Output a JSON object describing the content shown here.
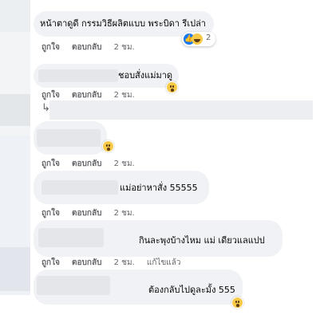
{
  "comments": [
    {
      "text": "หน้าตาดูดี กรรมวิธีผลิตแบบ พระบิดา รีเปล่า",
      "reaction_count": "2",
      "like": "ถูกใจ",
      "reply": "ตอบกลับ",
      "time": "2 ชม."
    },
    {
      "text": "ชอบสั่งแม่มาดู",
      "like": "ถูกใจ",
      "reply": "ตอบกลับ",
      "time": "2 ชม."
    },
    {
      "text": "",
      "like": "ถูกใจ",
      "reply": "ตอบกลับ",
      "time": "2 ชม."
    },
    {
      "text": "แม่อย่าหาสั่ง 55555",
      "like": "ถูกใจ",
      "reply": "ตอบกลับ",
      "time": "2 ชม."
    },
    {
      "text": "กินละพุงบ้างไหม แม่ เดียวแลแปป",
      "like": "ถูกใจ",
      "reply": "ตอบกลับ",
      "time": "2 ชม.",
      "edited": "แก้ไขแล้ว"
    },
    {
      "text": "ต้องกลับไปดูละมั้ง 555"
    }
  ],
  "reply_arrow": "↳",
  "colors": {
    "bubble": "#f0f2f5",
    "meta": "#65676b",
    "like_blue": "#1877f2",
    "emoji_yellow": "#f7c948"
  }
}
